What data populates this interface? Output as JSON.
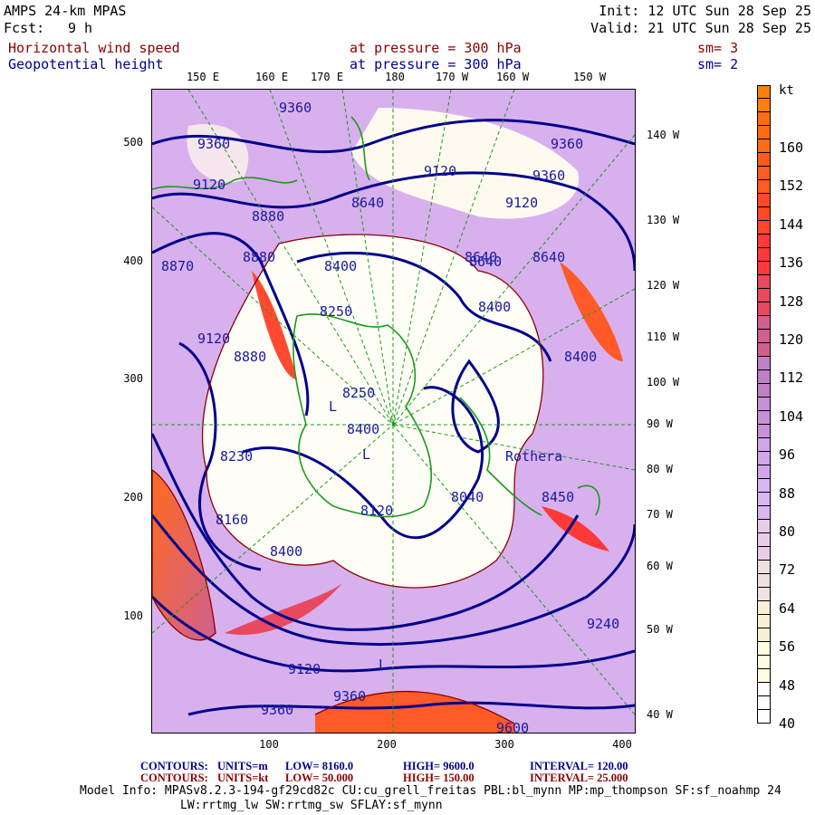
{
  "header": {
    "model": "AMPS 24-km MPAS",
    "fcst_label": "Fcst:",
    "fcst_value": "9 h",
    "init": "Init: 12 UTC Sun 28 Sep 25",
    "valid": "Valid: 21 UTC Sun 28 Sep 25",
    "field1": {
      "name": "Horizontal wind speed",
      "level": "at pressure =  300 hPa",
      "sm": "sm= 3",
      "color": "#8b0000"
    },
    "field2": {
      "name": "Geopotential height",
      "level": "at pressure =  300 hPa",
      "sm": "sm= 2",
      "color": "#00008b"
    }
  },
  "axes": {
    "top_lon": [
      "150 E",
      "160 E",
      "170 E",
      "180",
      "170 W",
      "160 W",
      "150 W"
    ],
    "right_lon": [
      "140 W",
      "130 W",
      "120 W",
      "110 W",
      "100 W",
      "90 W",
      "80 W",
      "70 W",
      "60 W",
      "50 W",
      "40 W"
    ],
    "left_y": [
      "500",
      "400",
      "300",
      "200",
      "100"
    ],
    "bottom_x": [
      "100",
      "200",
      "300",
      "400"
    ]
  },
  "contour_labels": [
    "9360",
    "9360",
    "9360",
    "9360",
    "9120",
    "9120",
    "9120",
    "9120",
    "8880",
    "8880",
    "8880",
    "8640",
    "8640",
    "8640",
    "8400",
    "8400",
    "8400",
    "8400",
    "8400",
    "8250",
    "8250",
    "8230",
    "8160",
    "8120",
    "8040",
    "8450",
    "8870",
    "8640",
    "9240",
    "9120",
    "9360",
    "9360",
    "9600",
    "Rothera",
    "L",
    "L",
    "L"
  ],
  "legend": {
    "contours1": {
      "label": "CONTOURS:",
      "units": "UNITS=m",
      "low": "LOW=  8160.0",
      "high": "HIGH=  9600.0",
      "interval": "INTERVAL=   120.00"
    },
    "contours2": {
      "label": "CONTOURS:",
      "units": "UNITS=kt",
      "low": "LOW=  50.000",
      "high": "HIGH=  150.00",
      "interval": "INTERVAL=   25.000"
    },
    "model_info": "Model Info: MPASv8.2.3-194-gf29cd82c CU:cu_grell_freitas PBL:bl_mynn MP:mp_thompson SF:sf_noahmp 24",
    "model_info2": "LW:rrtmg_lw SW:rrtmg_sw SFLAY:sf_mynn"
  },
  "colorbar": {
    "unit": "kt",
    "labels": [
      "160",
      "152",
      "144",
      "136",
      "128",
      "120",
      "112",
      "104",
      "96",
      "88",
      "80",
      "72",
      "64",
      "56",
      "48",
      "40"
    ],
    "range": [
      40,
      168
    ],
    "colors": [
      "#ffffff",
      "#fffde0",
      "#faf0d8",
      "#f0e0e0",
      "#e8cce8",
      "#dcb4f4",
      "#d2a6ea",
      "#c890d8",
      "#bf80c8",
      "#d06090",
      "#e84860",
      "#ff3838",
      "#ff4828",
      "#ff5a20",
      "#ff6c14",
      "#ff800a"
    ]
  }
}
